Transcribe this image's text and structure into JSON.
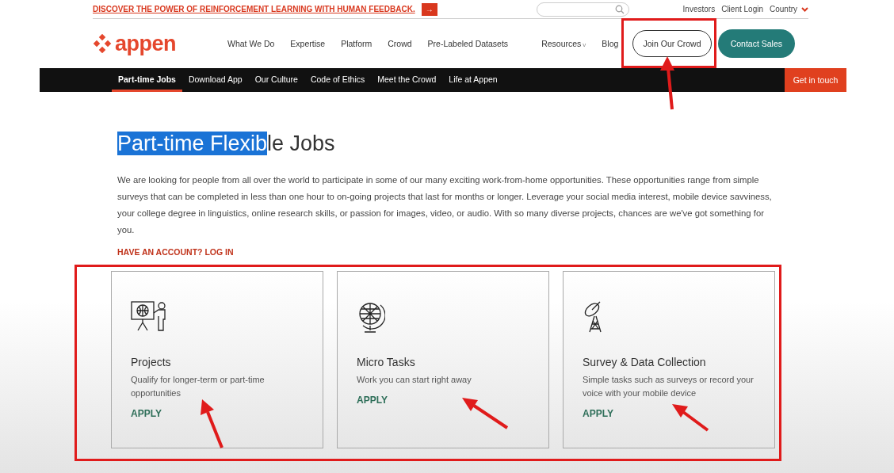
{
  "promo": {
    "text": "DISCOVER THE POWER OF REINFORCEMENT LEARNING WITH HUMAN FEEDBACK.",
    "arrow": "→"
  },
  "utility_links": [
    "Investors",
    "Client Login",
    "Country"
  ],
  "logo": {
    "text": "appen"
  },
  "nav": [
    {
      "label": "What We Do"
    },
    {
      "label": "Expertise"
    },
    {
      "label": "Platform"
    },
    {
      "label": "Crowd"
    },
    {
      "label": "Pre-Labeled Datasets"
    },
    {
      "label": "Resources",
      "caret": "v"
    },
    {
      "label": "Blog"
    }
  ],
  "join_button": "Join Our Crowd",
  "contact_button": "Contact Sales",
  "subnav": [
    {
      "label": "Part-time Jobs",
      "selected": true
    },
    {
      "label": "Download App",
      "selected": false
    },
    {
      "label": "Our Culture",
      "selected": false
    },
    {
      "label": "Code of Ethics",
      "selected": false
    },
    {
      "label": "Meet the Crowd",
      "selected": false
    },
    {
      "label": "Life at Appen",
      "selected": false
    }
  ],
  "get_in_touch": "Get in touch",
  "heading": [
    {
      "text": "Part-time Flexib",
      "selected": true
    },
    {
      "text": "le Jobs",
      "selected": false
    }
  ],
  "intro": "We are looking for people from all over the world to participate in some of our many exciting work-from-home opportunities. These opportunities range from simple surveys that can be completed in less than one hour to on-going projects that last for months or longer. Leverage your social media interest, mobile device savviness, your college degree in linguistics, online research skills, or passion for images, video, or audio. With so many diverse projects, chances are we've got something for you.",
  "login_link": "HAVE AN ACCOUNT? LOG IN",
  "cards": [
    {
      "kind": "presenter",
      "title": "Projects",
      "text": "Qualify for longer-term or part-time opportunities",
      "action": "APPLY"
    },
    {
      "kind": "globe",
      "title": "Micro Tasks",
      "text": "Work you can start right away",
      "action": "APPLY"
    },
    {
      "kind": "dish",
      "title": "Survey & Data Collection",
      "text": "Simple tasks such as surveys or record your voice with your mobile device",
      "action": "APPLY"
    }
  ]
}
